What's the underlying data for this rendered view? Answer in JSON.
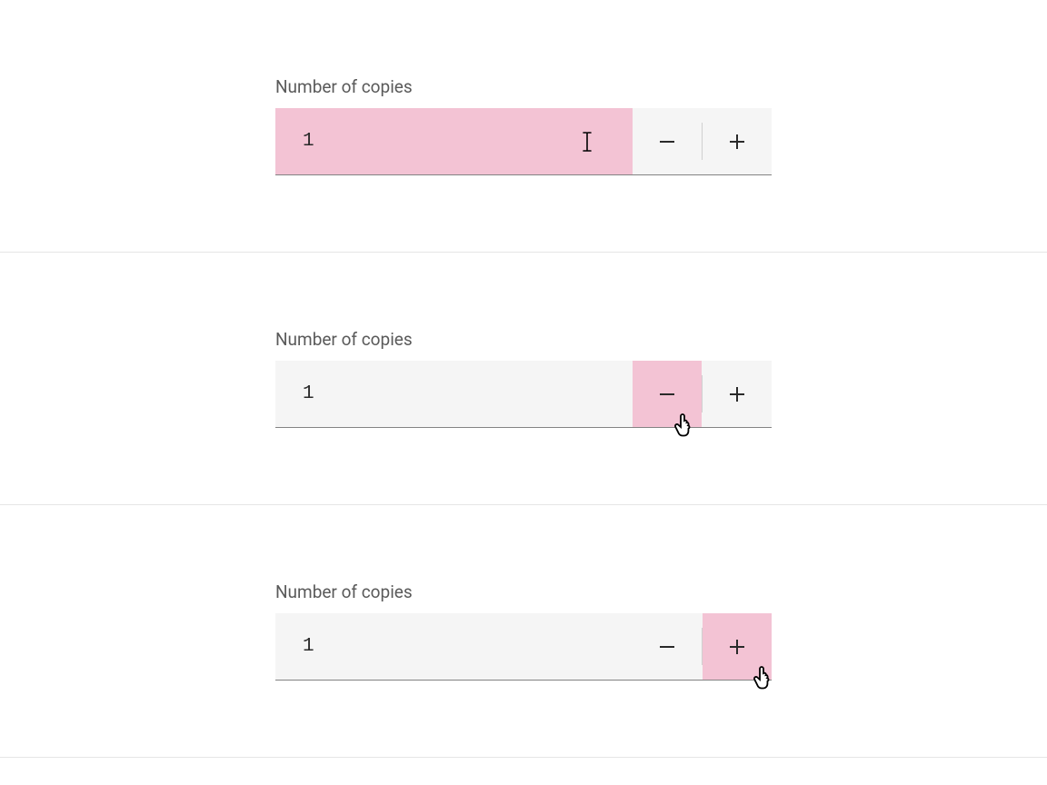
{
  "variants": {
    "inputHover": {
      "label": "Number of copies",
      "value": "1",
      "highlight": "input"
    },
    "minusHover": {
      "label": "Number of copies",
      "value": "1",
      "highlight": "minus"
    },
    "plusHover": {
      "label": "Number of copies",
      "value": "1",
      "highlight": "plus"
    }
  }
}
